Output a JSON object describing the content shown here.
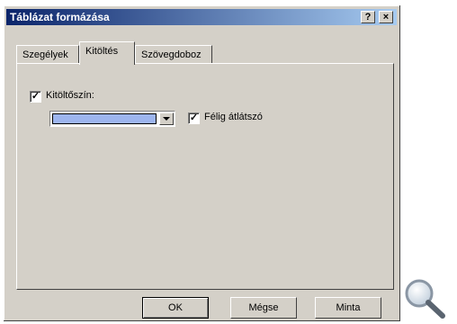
{
  "window": {
    "title": "Táblázat formázása",
    "help_label": "?",
    "close_label": "×"
  },
  "tabs": [
    {
      "label": "Szegélyek"
    },
    {
      "label": "Kitöltés"
    },
    {
      "label": "Szövegdoboz"
    }
  ],
  "fill": {
    "checkbox_label": "Kitöltőszín:",
    "checked": true,
    "color": "#9db5ef",
    "semi_transparent_label": "Félig átlátszó",
    "semi_transparent_checked": true
  },
  "buttons": {
    "ok": "OK",
    "cancel": "Mégse",
    "preview": "Minta"
  },
  "icons": {
    "zoom": "magnifier-icon"
  }
}
